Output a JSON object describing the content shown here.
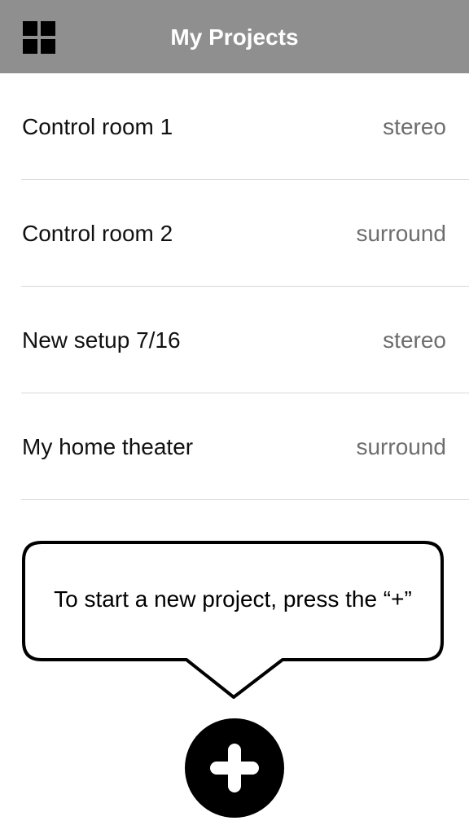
{
  "header": {
    "title": "My Projects",
    "menu_icon": "grid-icon",
    "background_color": "#8f8f8f"
  },
  "projects": [
    {
      "name": "Control room 1",
      "type": "stereo"
    },
    {
      "name": "Control room 2",
      "type": "surround"
    },
    {
      "name": "New setup 7/16",
      "type": "stereo"
    },
    {
      "name": "My home theater",
      "type": "surround"
    }
  ],
  "tooltip": {
    "text": "To start a new project, press the “+”"
  },
  "add_button": {
    "icon": "plus-icon"
  }
}
